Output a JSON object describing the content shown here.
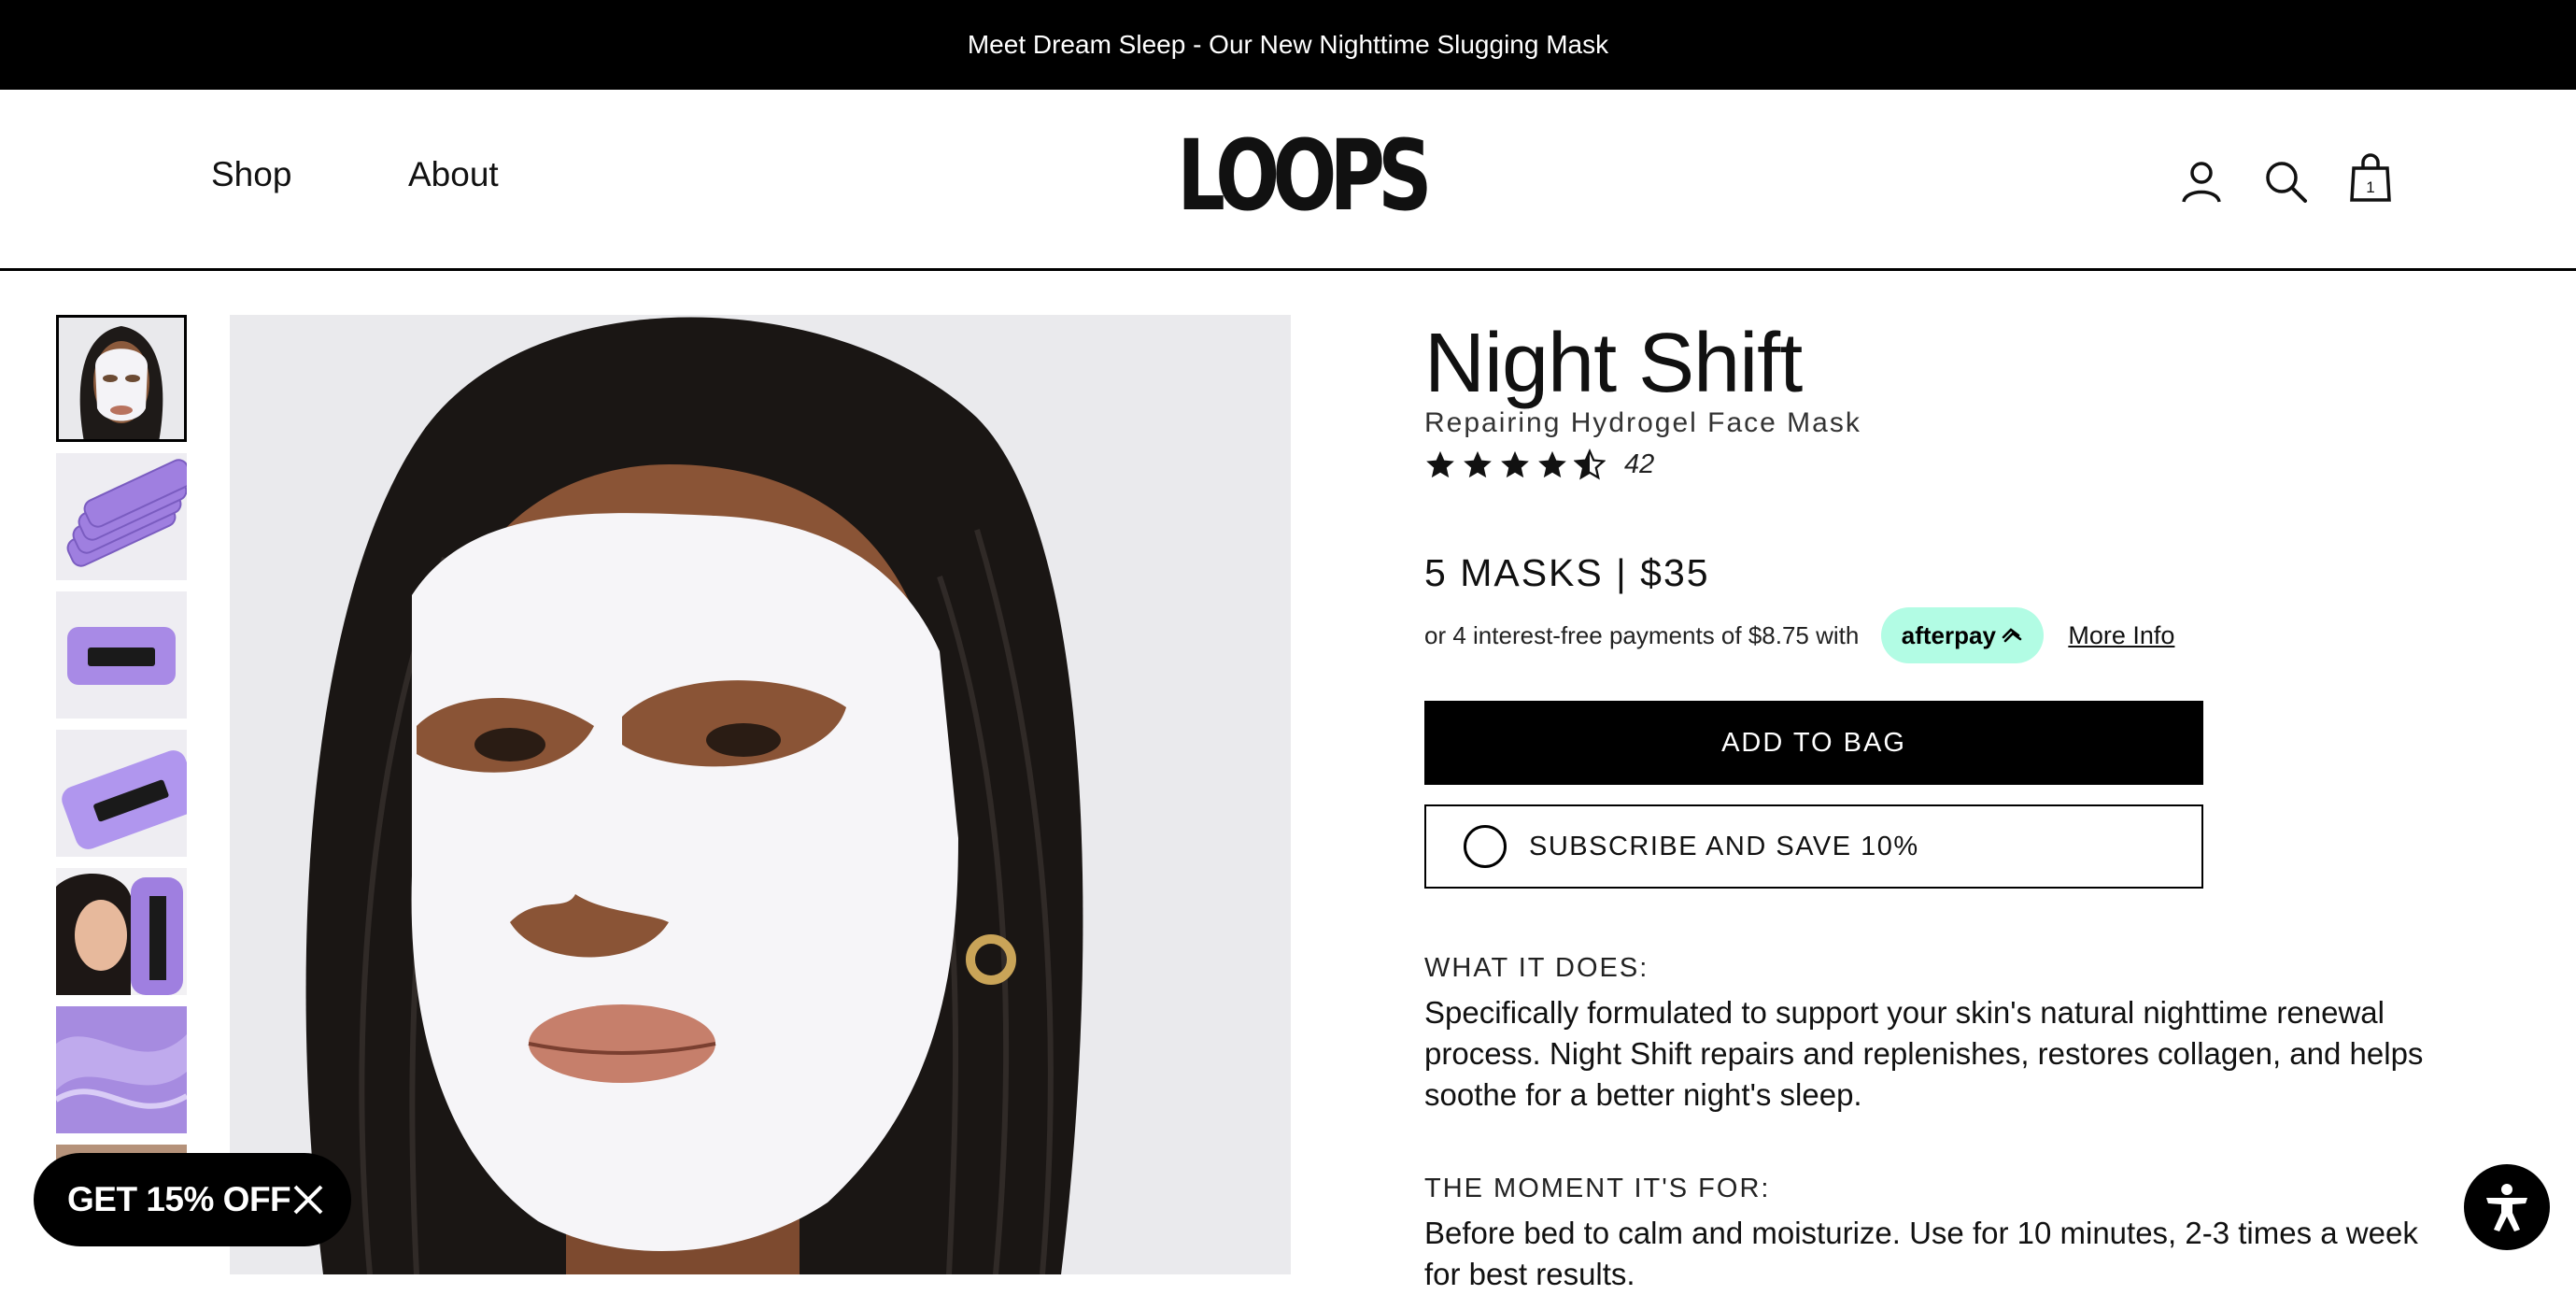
{
  "announcement": "Meet Dream Sleep - Our New Nighttime Slugging Mask",
  "nav": {
    "shop": "Shop",
    "about": "About"
  },
  "brand": {
    "logo_text": "LOOPS"
  },
  "header_icons": {
    "account": "account-icon",
    "search": "search-icon",
    "bag": "bag-icon",
    "bag_count": "1"
  },
  "product": {
    "title": "Night Shift",
    "subtitle": "Repairing Hydrogel Face Mask",
    "rating": 4.5,
    "review_count": "42",
    "price": "5 MASKS | $35",
    "afterpay_text": "or 4 interest-free payments of $8.75 with",
    "afterpay_badge": "afterpay",
    "more_info": "More Info",
    "add_to_bag": "ADD TO BAG",
    "subscribe": "SUBSCRIBE AND SAVE 10%",
    "sections": [
      {
        "heading": "WHAT IT DOES:",
        "body": "Specifically formulated to support your skin's natural nighttime renewal process. Night Shift repairs and replenishes, restores collagen, and helps soothe for a better night's sleep."
      },
      {
        "heading": "THE MOMENT IT'S FOR:",
        "body": "Before bed to calm and moisturize. Use for 10 minutes, 2-3 times a week for best results."
      }
    ]
  },
  "promo": {
    "label": "GET 15% OFF"
  },
  "colors": {
    "black": "#000000",
    "afterpay_mint": "#b2fce4",
    "lavender": "#a98ee6",
    "background": "#ffffff"
  }
}
